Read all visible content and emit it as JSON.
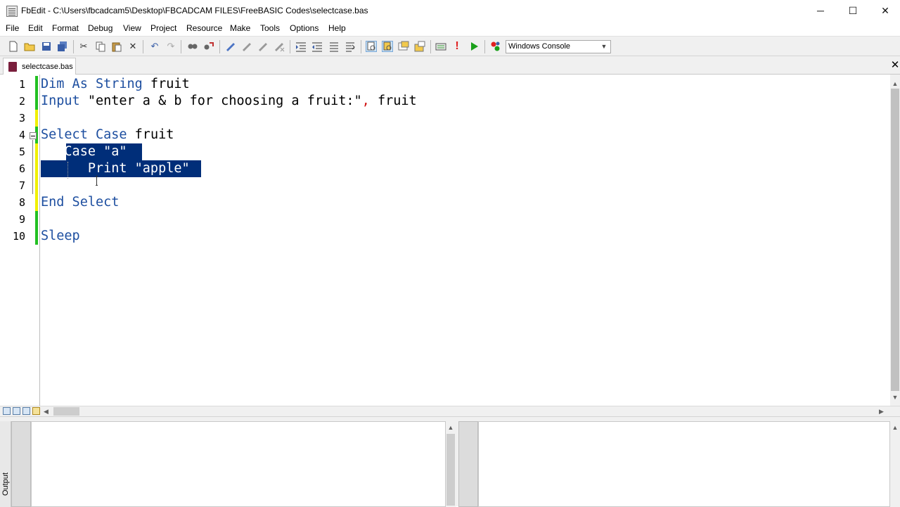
{
  "window": {
    "title": "FbEdit - C:\\Users\\fbcadcam5\\Desktop\\FBCADCAM FILES\\FreeBASIC Codes\\selectcase.bas",
    "minimize_glyph": "─",
    "maximize_glyph": "☐",
    "close_glyph": "✕"
  },
  "menubar": {
    "items": [
      "File",
      "Edit",
      "Format",
      "Debug",
      "View",
      "Project",
      "Resource",
      "Make",
      "Tools",
      "Options",
      "Help"
    ]
  },
  "toolbar": {
    "build_type": "Windows Console",
    "icons": [
      "new-file-icon",
      "open-file-icon",
      "save-icon",
      "save-all-icon",
      "cut-icon",
      "copy-icon",
      "paste-icon",
      "delete-icon",
      "undo-icon",
      "redo-icon",
      "find-icon",
      "replace-icon",
      "toggle-bookmark-icon",
      "next-bookmark-icon",
      "previous-bookmark-icon",
      "clear-bookmarks-icon",
      "indent-icon",
      "outdent-icon",
      "comment-icon",
      "uncomment-icon",
      "toggle-output-icon",
      "toggle-project-icon",
      "toggle-properties-icon",
      "toggle-tabtools-icon",
      "compile-icon",
      "build-icon",
      "run-icon",
      "debug-icon"
    ]
  },
  "tabs": [
    {
      "label": "selectcase.bas",
      "active": true
    }
  ],
  "editor": {
    "line_numbers": [
      "1",
      "2",
      "3",
      "4",
      "5",
      "6",
      "7",
      "8",
      "9",
      "10"
    ],
    "code": {
      "line1": {
        "kw1": "Dim As String",
        "id": " fruit"
      },
      "line2": {
        "kw": "Input",
        "str": " \"enter a & b for choosing a fruit:\"",
        "punc": ",",
        "id": " fruit"
      },
      "line4": {
        "kw": "Select Case",
        "id": " fruit"
      },
      "line5": {
        "indent": "   ",
        "selected": "Case \"a\""
      },
      "line6": {
        "selected": "      Print \"apple\""
      },
      "line8": {
        "kw": "End Select"
      },
      "line10": {
        "kw": "Sleep"
      }
    },
    "selection_color": "#002e79",
    "keyword_color": "#1e4fa0",
    "change_bar_colors": {
      "saved": "#22c022",
      "modified": "#f0f000"
    }
  },
  "output": {
    "label": "Output"
  }
}
